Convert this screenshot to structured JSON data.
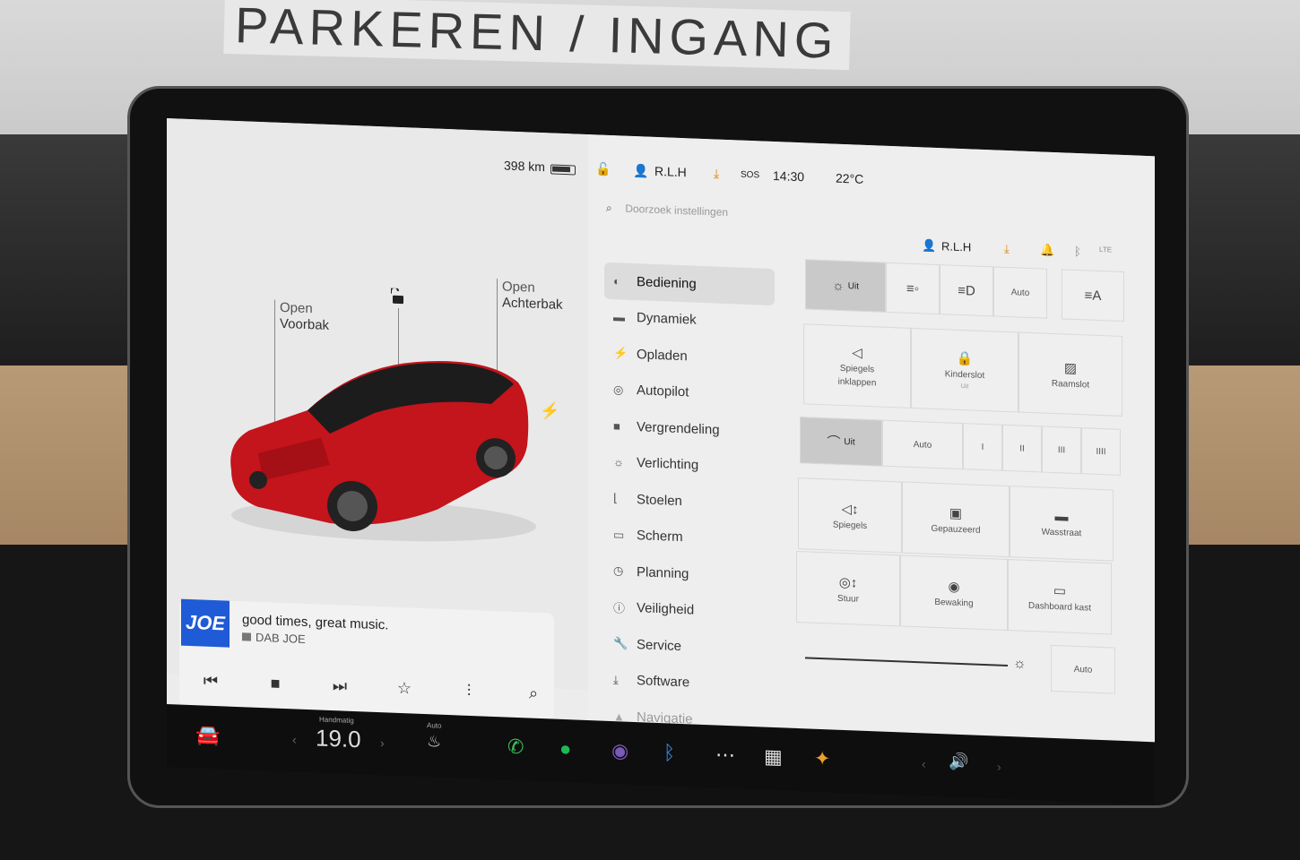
{
  "environment": {
    "sign_text": "PARKEREN / INGANG"
  },
  "car_panel": {
    "range": "398 km",
    "frunk": {
      "action": "Open",
      "name": "Voorbak"
    },
    "trunk": {
      "action": "Open",
      "name": "Achterbak"
    },
    "car_color": "#c4141c"
  },
  "media": {
    "station_logo": "JOE",
    "track": "good times, great music.",
    "source": "DAB JOE",
    "controls": [
      "previous-icon",
      "stop-icon",
      "next-icon",
      "favorite-icon",
      "equalizer-icon",
      "search-icon"
    ]
  },
  "status_bar": {
    "user": "R.L.H",
    "sos": "SOS",
    "time": "14:30",
    "temperature": "22°C"
  },
  "search": {
    "placeholder": "Doorzoek instellingen"
  },
  "profile": {
    "user": "R.L.H",
    "lte": "LTE"
  },
  "menu": {
    "items": [
      {
        "label": "Bediening",
        "icon": "toggle-icon",
        "active": true
      },
      {
        "label": "Dynamiek",
        "icon": "car-icon"
      },
      {
        "label": "Opladen",
        "icon": "bolt-icon"
      },
      {
        "label": "Autopilot",
        "icon": "steering-wheel-icon"
      },
      {
        "label": "Vergrendeling",
        "icon": "lock-icon"
      },
      {
        "label": "Verlichting",
        "icon": "light-icon"
      },
      {
        "label": "Stoelen",
        "icon": "seat-icon"
      },
      {
        "label": "Scherm",
        "icon": "display-icon"
      },
      {
        "label": "Planning",
        "icon": "clock-icon"
      },
      {
        "label": "Veiligheid",
        "icon": "info-icon"
      },
      {
        "label": "Service",
        "icon": "wrench-icon"
      },
      {
        "label": "Software",
        "icon": "download-icon"
      },
      {
        "label": "Navigatie",
        "icon": "navigation-icon"
      }
    ]
  },
  "controls": {
    "lights": {
      "off": "Uit",
      "auto": "Auto"
    },
    "mirrors_fold": {
      "line1": "Spiegels",
      "line2": "inklappen"
    },
    "child_lock": {
      "label": "Kinderslot",
      "state": "Uit"
    },
    "window_lock": "Raamslot",
    "wipers": {
      "off": "Uit",
      "auto": "Auto",
      "levels": [
        "I",
        "II",
        "III",
        "IIII"
      ]
    },
    "mirrors": "Spiegels",
    "paused": "Gepauzeerd",
    "car_wash": "Wasstraat",
    "steering": "Stuur",
    "sentry": "Bewaking",
    "glovebox": "Dashboard kast",
    "brightness_auto": "Auto"
  },
  "dock": {
    "climate_mode": "Handmatig",
    "temperature": "19.0",
    "seat_heat_mode": "Auto"
  }
}
